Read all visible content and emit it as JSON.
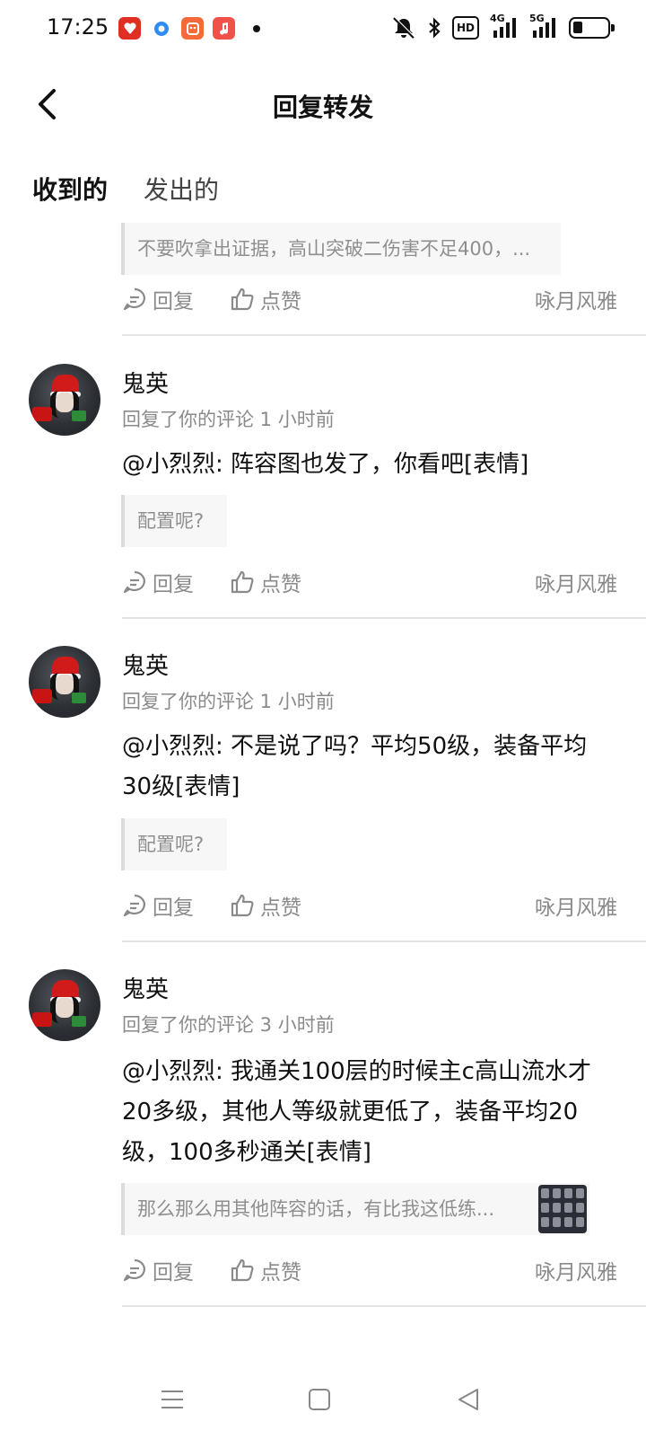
{
  "status_bar": {
    "time": "17:25",
    "app_icons": [
      "pinduoduo-icon",
      "browser-icon",
      "game-icon",
      "music-icon"
    ],
    "network_hd": "HD",
    "network_4g": "4G",
    "network_5g": "5G"
  },
  "header": {
    "title": "回复转发"
  },
  "tabs": [
    {
      "label": "收到的",
      "active": true
    },
    {
      "label": "发出的",
      "active": false
    }
  ],
  "accent_color": "#19c6b0",
  "items": [
    {
      "quote": "不要吹拿出证据，高山突破二伤害不足400，...",
      "reply_label": "回复",
      "like_label": "点赞",
      "author": "咏月风雅"
    },
    {
      "username": "鬼英",
      "meta": "回复了你的评论 1 小时前",
      "content": "@小烈烈: 阵容图也发了，你看吧[表情]",
      "quote": "配置呢?",
      "reply_label": "回复",
      "like_label": "点赞",
      "author": "咏月风雅"
    },
    {
      "username": "鬼英",
      "meta": "回复了你的评论 1 小时前",
      "content": "@小烈烈: 不是说了吗？平均50级，装备平均30级[表情]",
      "quote": "配置呢?",
      "reply_label": "回复",
      "like_label": "点赞",
      "author": "咏月风雅"
    },
    {
      "username": "鬼英",
      "meta": "回复了你的评论 3 小时前",
      "content": "@小烈烈: 我通关100层的时候主c高山流水才20多级，其他人等级就更低了，装备平均20级，100多秒通关[表情]",
      "quote": "那么那么用其他阵容的话，有比我这低练...",
      "reply_label": "回复",
      "like_label": "点赞",
      "author": "咏月风雅"
    }
  ]
}
